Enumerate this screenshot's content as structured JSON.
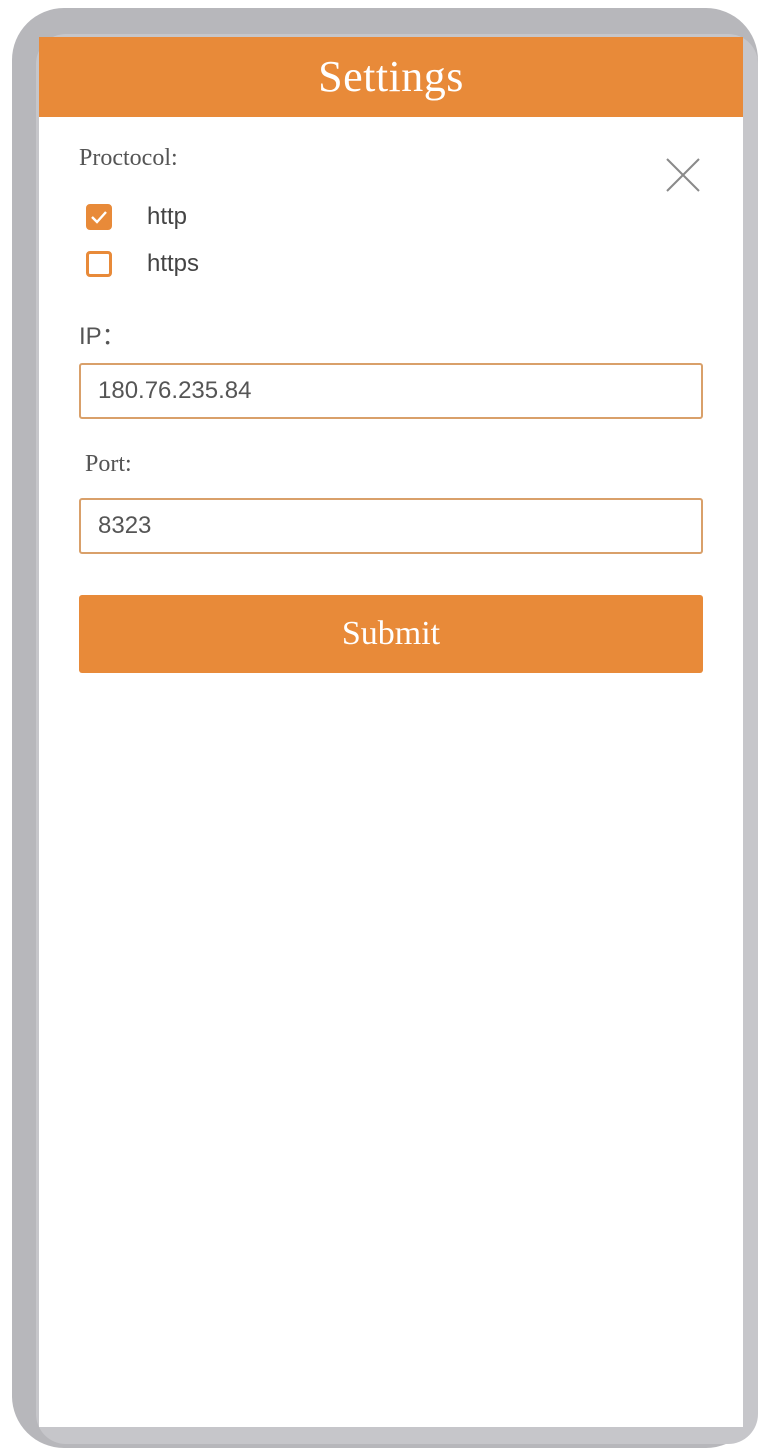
{
  "header": {
    "title": "Settings"
  },
  "protocol": {
    "label": "Proctocol:",
    "options": [
      {
        "label": "http",
        "checked": true
      },
      {
        "label": "https",
        "checked": false
      }
    ]
  },
  "ip": {
    "label": "IP：",
    "value": "180.76.235.84"
  },
  "port": {
    "label": "Port:",
    "value": "8323"
  },
  "submit": {
    "label": "Submit"
  },
  "icons": {
    "close": "close-icon",
    "check": "check-icon"
  },
  "colors": {
    "accent": "#e88a39",
    "input_border": "#d9a06a",
    "text": "#555555"
  }
}
